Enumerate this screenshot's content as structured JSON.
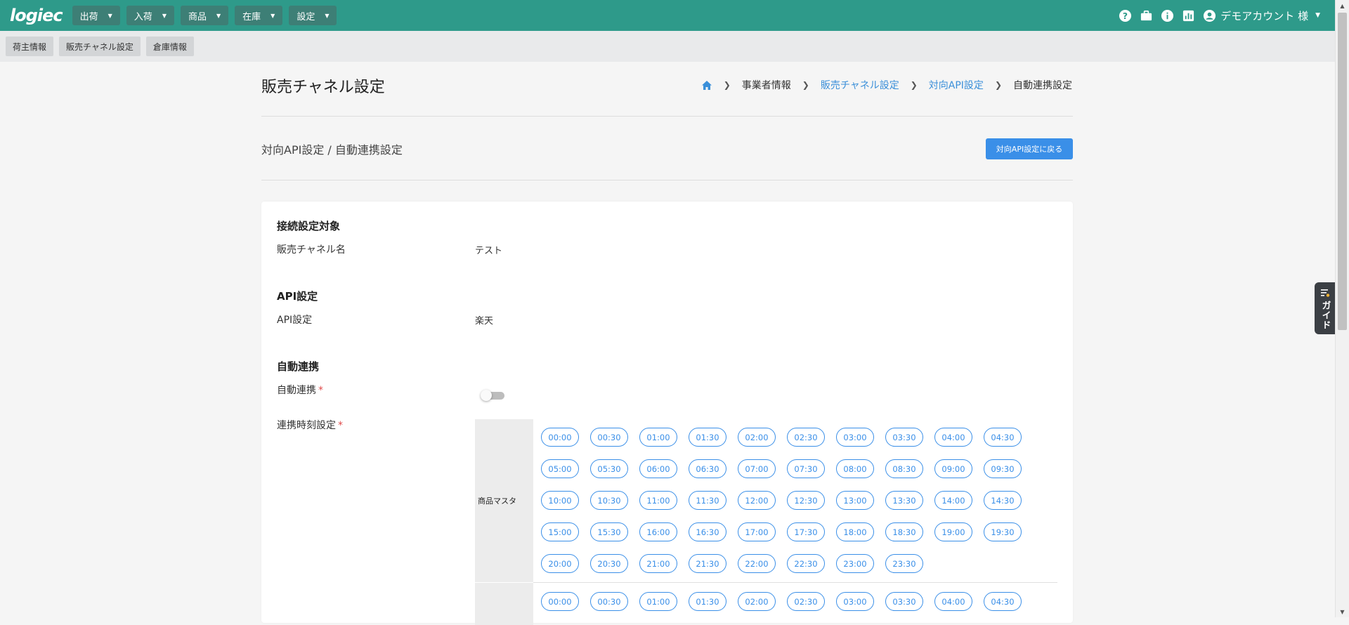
{
  "header": {
    "logo": "logiec",
    "menus": [
      {
        "label": "出荷"
      },
      {
        "label": "入荷"
      },
      {
        "label": "商品"
      },
      {
        "label": "在庫"
      },
      {
        "label": "設定"
      }
    ],
    "account_label": "デモアカウント 様",
    "icons": [
      "help-icon",
      "briefcase-icon",
      "info-icon",
      "chart-icon",
      "account-circle-icon"
    ]
  },
  "subnav": {
    "items": [
      {
        "label": "荷主情報"
      },
      {
        "label": "販売チャネル設定"
      },
      {
        "label": "倉庫情報"
      }
    ]
  },
  "page": {
    "title": "販売チャネル設定",
    "breadcrumb": [
      {
        "label": "事業者情報"
      },
      {
        "label": "販売チャネル設定"
      },
      {
        "label": "対向API設定"
      },
      {
        "label": "自動連携設定"
      }
    ],
    "subtitle": "対向API設定 / 自動連携設定",
    "back_button": "対向API設定に戻る"
  },
  "guide": {
    "label": "ガイド"
  },
  "sections": {
    "target": {
      "title": "接続設定対象",
      "label": "販売チャネル名",
      "value": "テスト"
    },
    "api": {
      "title": "API設定",
      "label": "API設定",
      "value": "楽天"
    },
    "auto": {
      "title": "自動連携",
      "toggle_label": "自動連携",
      "toggle_on": false,
      "time_label": "連携時刻設定",
      "required_mark": "*"
    }
  },
  "schedule": {
    "group1_label": "商品マスタ",
    "group1_times": [
      "00:00",
      "00:30",
      "01:00",
      "01:30",
      "02:00",
      "02:30",
      "03:00",
      "03:30",
      "04:00",
      "04:30",
      "05:00",
      "05:30",
      "06:00",
      "06:30",
      "07:00",
      "07:30",
      "08:00",
      "08:30",
      "09:00",
      "09:30",
      "10:00",
      "10:30",
      "11:00",
      "11:30",
      "12:00",
      "12:30",
      "13:00",
      "13:30",
      "14:00",
      "14:30",
      "15:00",
      "15:30",
      "16:00",
      "16:30",
      "17:00",
      "17:30",
      "18:00",
      "18:30",
      "19:00",
      "19:30",
      "20:00",
      "20:30",
      "21:00",
      "21:30",
      "22:00",
      "22:30",
      "23:00",
      "23:30"
    ],
    "group2_times": [
      "00:00",
      "00:30",
      "01:00",
      "01:30",
      "02:00",
      "02:30",
      "03:00",
      "03:30",
      "04:00",
      "04:30"
    ]
  },
  "colors": {
    "header": "#2e9a8a",
    "accent": "#3a8fe8",
    "required": "#e04b4b"
  }
}
